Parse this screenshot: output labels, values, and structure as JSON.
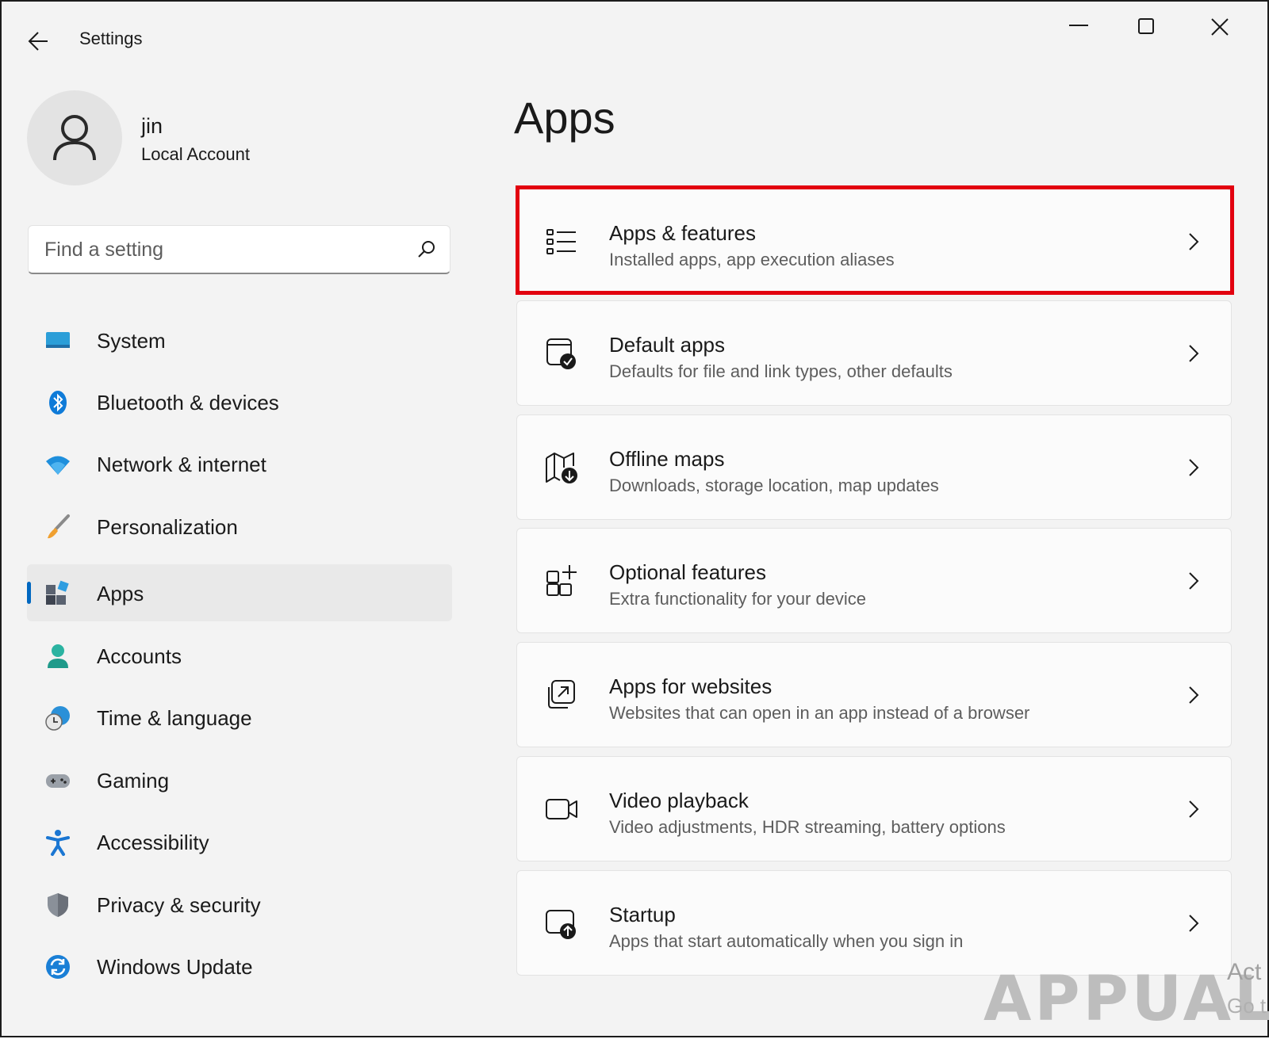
{
  "window": {
    "title": "Settings"
  },
  "user": {
    "name": "jin",
    "account_type": "Local Account"
  },
  "search": {
    "placeholder": "Find a setting"
  },
  "sidebar": {
    "items": [
      {
        "label": "System",
        "icon": "system-icon"
      },
      {
        "label": "Bluetooth & devices",
        "icon": "bluetooth-icon"
      },
      {
        "label": "Network & internet",
        "icon": "wifi-icon"
      },
      {
        "label": "Personalization",
        "icon": "brush-icon"
      },
      {
        "label": "Apps",
        "icon": "apps-icon",
        "selected": true
      },
      {
        "label": "Accounts",
        "icon": "accounts-icon"
      },
      {
        "label": "Time & language",
        "icon": "clock-globe-icon"
      },
      {
        "label": "Gaming",
        "icon": "gamepad-icon"
      },
      {
        "label": "Accessibility",
        "icon": "accessibility-icon"
      },
      {
        "label": "Privacy & security",
        "icon": "shield-icon"
      },
      {
        "label": "Windows Update",
        "icon": "update-icon"
      }
    ]
  },
  "main": {
    "title": "Apps",
    "cards": [
      {
        "title": "Apps & features",
        "subtitle": "Installed apps, app execution aliases",
        "icon": "list-icon",
        "highlighted": true
      },
      {
        "title": "Default apps",
        "subtitle": "Defaults for file and link types, other defaults",
        "icon": "default-apps-icon"
      },
      {
        "title": "Offline maps",
        "subtitle": "Downloads, storage location, map updates",
        "icon": "map-download-icon"
      },
      {
        "title": "Optional features",
        "subtitle": "Extra functionality for your device",
        "icon": "add-grid-icon"
      },
      {
        "title": "Apps for websites",
        "subtitle": "Websites that can open in an app instead of a browser",
        "icon": "open-link-icon"
      },
      {
        "title": "Video playback",
        "subtitle": "Video adjustments, HDR streaming, battery options",
        "icon": "video-icon"
      },
      {
        "title": "Startup",
        "subtitle": "Apps that start automatically when you sign in",
        "icon": "startup-icon"
      }
    ]
  },
  "watermark": {
    "brand": "APPUALS",
    "activation_line1": "Act",
    "activation_line2": "Go t"
  },
  "colors": {
    "accent": "#0067c0",
    "highlight_box": "#e2000f",
    "window_bg": "#f3f3f3",
    "card_bg": "#fbfbfb"
  }
}
